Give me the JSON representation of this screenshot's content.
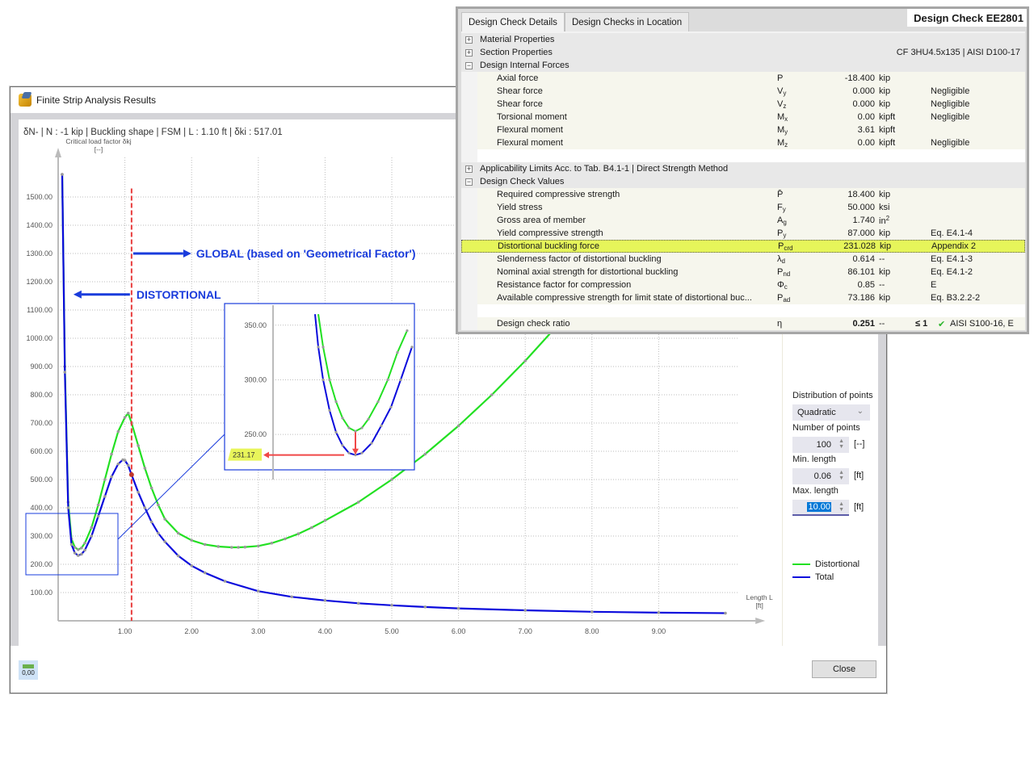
{
  "fsm_dialog": {
    "title": "Finite Strip Analysis Results",
    "info_line": "δN- | N : -1 kip | Buckling shape | FSM | L : 1.10 ft | δki : 517.01",
    "close_label": "Close",
    "units_button_label": "0,00",
    "settings": {
      "distribution_label": "Distribution of points",
      "distribution_value": "Quadratic",
      "num_points_label": "Number of points",
      "num_points_value": "100",
      "num_points_unit": "[--]",
      "min_length_label": "Min. length",
      "min_length_value": "0.06",
      "min_length_unit": "[ft]",
      "max_length_label": "Max. length",
      "max_length_value": "10.00",
      "max_length_unit": "[ft]"
    },
    "legend": [
      {
        "label": "Distortional",
        "color": "#22e022"
      },
      {
        "label": "Total",
        "color": "#0a0adc"
      }
    ]
  },
  "chart_data": {
    "type": "line",
    "title": "",
    "ylabel": "Critical load factor δkj",
    "ylabel_unit": "[--]",
    "xlabel": "Length L",
    "xlabel_unit": "[ft]",
    "xlim": [
      0,
      10
    ],
    "ylim": [
      0,
      1600
    ],
    "x_ticks": [
      "1.00",
      "2.00",
      "3.00",
      "4.00",
      "5.00",
      "6.00",
      "7.00",
      "8.00",
      "9.00"
    ],
    "y_ticks": [
      "100.00",
      "200.00",
      "300.00",
      "400.00",
      "500.00",
      "600.00",
      "700.00",
      "800.00",
      "900.00",
      "1000.00",
      "1100.00",
      "1200.00",
      "1300.00",
      "1400.00",
      "1500.00"
    ],
    "grid": true,
    "legend_position": "right",
    "selected_length": 1.1,
    "selected_value": 517.01,
    "series": [
      {
        "name": "Distortional",
        "color": "#22e022",
        "x": [
          0.06,
          0.1,
          0.15,
          0.2,
          0.25,
          0.3,
          0.35,
          0.4,
          0.5,
          0.6,
          0.7,
          0.8,
          0.9,
          1.0,
          1.05,
          1.1,
          1.2,
          1.3,
          1.4,
          1.5,
          1.6,
          1.8,
          2.0,
          2.2,
          2.4,
          2.6,
          2.7,
          2.8,
          3.0,
          3.2,
          3.4,
          3.6,
          3.8,
          4.0,
          4.5,
          5.0,
          5.5,
          6.0,
          6.5,
          7.0,
          7.5,
          7.66
        ],
        "y": [
          1580,
          900,
          420,
          290,
          260,
          252,
          258,
          275,
          330,
          410,
          500,
          590,
          670,
          720,
          735,
          700,
          620,
          540,
          470,
          410,
          360,
          310,
          285,
          270,
          263,
          260,
          260,
          261,
          265,
          275,
          290,
          308,
          330,
          355,
          420,
          500,
          590,
          690,
          800,
          920,
          1050,
          1100
        ]
      },
      {
        "name": "Total",
        "color": "#0a0adc",
        "x": [
          0.06,
          0.1,
          0.15,
          0.2,
          0.25,
          0.3,
          0.35,
          0.4,
          0.5,
          0.6,
          0.7,
          0.8,
          0.9,
          0.97,
          1.0,
          1.05,
          1.1,
          1.2,
          1.3,
          1.4,
          1.5,
          1.6,
          1.8,
          2.0,
          2.2,
          2.5,
          3.0,
          3.5,
          4.0,
          4.5,
          5.0,
          5.5,
          6.0,
          7.0,
          8.0,
          9.0,
          10.0
        ],
        "y": [
          1580,
          880,
          400,
          270,
          240,
          231.17,
          236,
          250,
          300,
          370,
          440,
          510,
          555,
          570,
          568,
          550,
          517,
          455,
          400,
          350,
          310,
          280,
          230,
          195,
          170,
          140,
          105,
          85,
          72,
          62,
          55,
          49,
          44,
          37,
          32,
          29,
          27
        ]
      }
    ],
    "annotations": [
      {
        "text": "GLOBAL (based on 'Geometrical Factor')",
        "color": "#1a3cdc"
      },
      {
        "text": "DISTORTIONAL",
        "color": "#1a3cdc"
      }
    ],
    "inset": {
      "y_ticks": [
        "250.00",
        "300.00",
        "350.00"
      ],
      "highlight_value": "231.17",
      "highlight_color": "#e8f55a"
    }
  },
  "design_check": {
    "title": "Design Check EE2801",
    "tabs": [
      "Design Check Details",
      "Design Checks in Location"
    ],
    "groups": {
      "material": {
        "label": "Material Properties",
        "expanded": false
      },
      "section": {
        "label": "Section Properties",
        "expanded": false,
        "right": "CF 3HU4.5x135 | AISI D100-17"
      },
      "forces": {
        "label": "Design Internal Forces",
        "expanded": true
      },
      "applicability": {
        "label": "Applicability Limits Acc. to Tab. B4.1-1 | Direct Strength Method",
        "expanded": false
      },
      "values": {
        "label": "Design Check Values",
        "expanded": true
      }
    },
    "forces_rows": [
      {
        "name": "Axial force",
        "sym": "P",
        "sub": "",
        "val": "-18.400",
        "unit": "kip",
        "ref": ""
      },
      {
        "name": "Shear force",
        "sym": "V",
        "sub": "y",
        "val": "0.000",
        "unit": "kip",
        "ref": "Negligible"
      },
      {
        "name": "Shear force",
        "sym": "V",
        "sub": "z",
        "val": "0.000",
        "unit": "kip",
        "ref": "Negligible"
      },
      {
        "name": "Torsional moment",
        "sym": "M",
        "sub": "x",
        "val": "0.00",
        "unit": "kipft",
        "ref": "Negligible"
      },
      {
        "name": "Flexural moment",
        "sym": "M",
        "sub": "y",
        "val": "3.61",
        "unit": "kipft",
        "ref": ""
      },
      {
        "name": "Flexural moment",
        "sym": "M",
        "sub": "z",
        "val": "0.00",
        "unit": "kipft",
        "ref": "Negligible"
      }
    ],
    "values_rows": [
      {
        "name": "Required compressive strength",
        "sym": "P̄",
        "sub": "",
        "val": "18.400",
        "unit": "kip",
        "ref": ""
      },
      {
        "name": "Yield stress",
        "sym": "F",
        "sub": "y",
        "val": "50.000",
        "unit": "ksi",
        "ref": ""
      },
      {
        "name": "Gross area of member",
        "sym": "A",
        "sub": "g",
        "val": "1.740",
        "unit": "in",
        "sup": "2",
        "ref": ""
      },
      {
        "name": "Yield compressive strength",
        "sym": "P",
        "sub": "y",
        "val": "87.000",
        "unit": "kip",
        "ref": "Eq. E4.1-4"
      },
      {
        "name": "Distortional buckling force",
        "sym": "P",
        "sub": "crd",
        "val": "231.028",
        "unit": "kip",
        "ref": "Appendix 2",
        "highlight": true
      },
      {
        "name": "Slenderness factor of distortional buckling",
        "sym": "λ",
        "sub": "d",
        "val": "0.614",
        "unit": "--",
        "ref": "Eq. E4.1-3"
      },
      {
        "name": "Nominal axial strength for distortional buckling",
        "sym": "P",
        "sub": "nd",
        "val": "86.101",
        "unit": "kip",
        "ref": "Eq. E4.1-2"
      },
      {
        "name": "Resistance factor for compression",
        "sym": "Φ",
        "sub": "c",
        "val": "0.85",
        "unit": "--",
        "ref": "E"
      },
      {
        "name": "Available compressive strength for limit state of distortional buc...",
        "sym": "P",
        "sub": "ad",
        "val": "73.186",
        "unit": "kip",
        "ref": "Eq. B3.2.2-2"
      }
    ],
    "ratio_row": {
      "name": "Design check ratio",
      "sym": "η",
      "val": "0.251",
      "unit": "--",
      "cmp": "≤ 1",
      "ok": "✔",
      "ref": "AISI S100-16, E"
    }
  }
}
